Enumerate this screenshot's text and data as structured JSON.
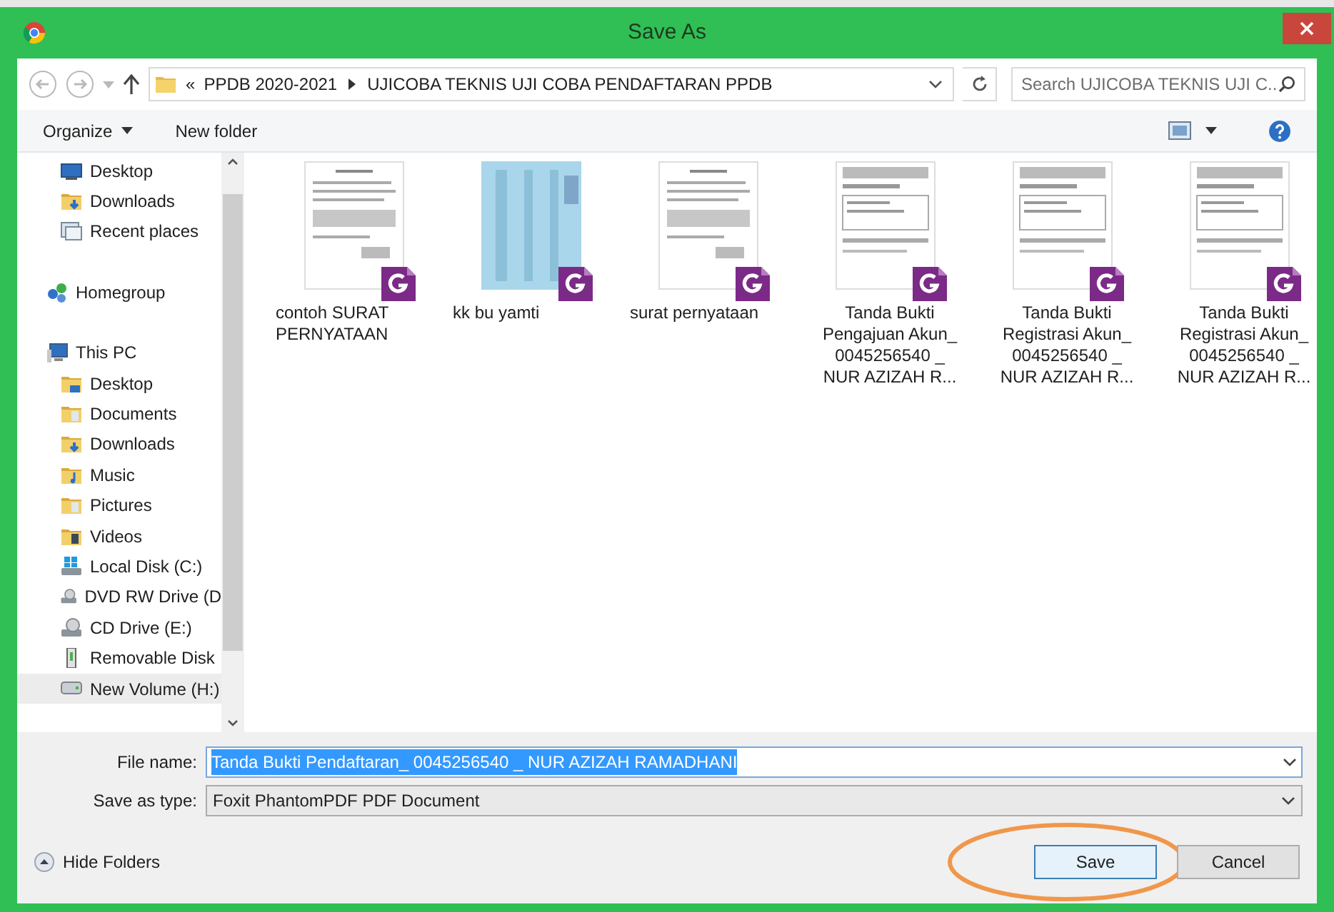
{
  "window": {
    "title": "Save As"
  },
  "address_bar": {
    "path": [
      {
        "label": "PPDB 2020-2021"
      },
      {
        "label": "UJICOBA TEKNIS UJI COBA PENDAFTARAN PPDB"
      }
    ],
    "overflow": "«"
  },
  "search": {
    "placeholder": "Search UJICOBA TEKNIS UJI C..."
  },
  "toolbar": {
    "organize": "Organize",
    "new_folder": "New folder"
  },
  "sidebar": {
    "items": [
      {
        "label": "Desktop",
        "selected": false
      },
      {
        "label": "Downloads",
        "selected": false
      },
      {
        "label": "Recent places",
        "selected": false
      },
      {
        "label": "Homegroup",
        "selected": false
      },
      {
        "label": "This PC",
        "selected": false
      },
      {
        "label": "Desktop",
        "selected": false
      },
      {
        "label": "Documents",
        "selected": false
      },
      {
        "label": "Downloads",
        "selected": false
      },
      {
        "label": "Music",
        "selected": false
      },
      {
        "label": "Pictures",
        "selected": false
      },
      {
        "label": "Videos",
        "selected": false
      },
      {
        "label": "Local Disk (C:)",
        "selected": false
      },
      {
        "label": "DVD RW Drive (D",
        "selected": false
      },
      {
        "label": "CD Drive (E:)",
        "selected": false
      },
      {
        "label": "Removable Disk",
        "selected": false
      },
      {
        "label": "New Volume (H:)",
        "selected": true
      }
    ]
  },
  "files": [
    {
      "label": "contoh SURAT\nPERNYATAAN"
    },
    {
      "label": "kk bu yamti"
    },
    {
      "label": "surat pernyataan"
    },
    {
      "label": "Tanda Bukti\nPengajuan Akun_\n0045256540 _\nNUR AZIZAH R..."
    },
    {
      "label": "Tanda Bukti\nRegistrasi Akun_\n0045256540 _\nNUR AZIZAH R..."
    },
    {
      "label": "Tanda Bukti\nRegistrasi Akun_\n0045256540 _\nNUR AZIZAH R..."
    }
  ],
  "file_name": {
    "label": "File name:",
    "value": "Tanda Bukti Pendaftaran_ 0045256540 _ NUR AZIZAH RAMADHANI"
  },
  "save_as_type": {
    "label": "Save as type:",
    "value": "Foxit PhantomPDF PDF Document"
  },
  "hide_folders": "Hide Folders",
  "buttons": [
    {
      "label": "Save",
      "highlighted": true
    },
    {
      "label": "Cancel",
      "highlighted": false
    }
  ]
}
